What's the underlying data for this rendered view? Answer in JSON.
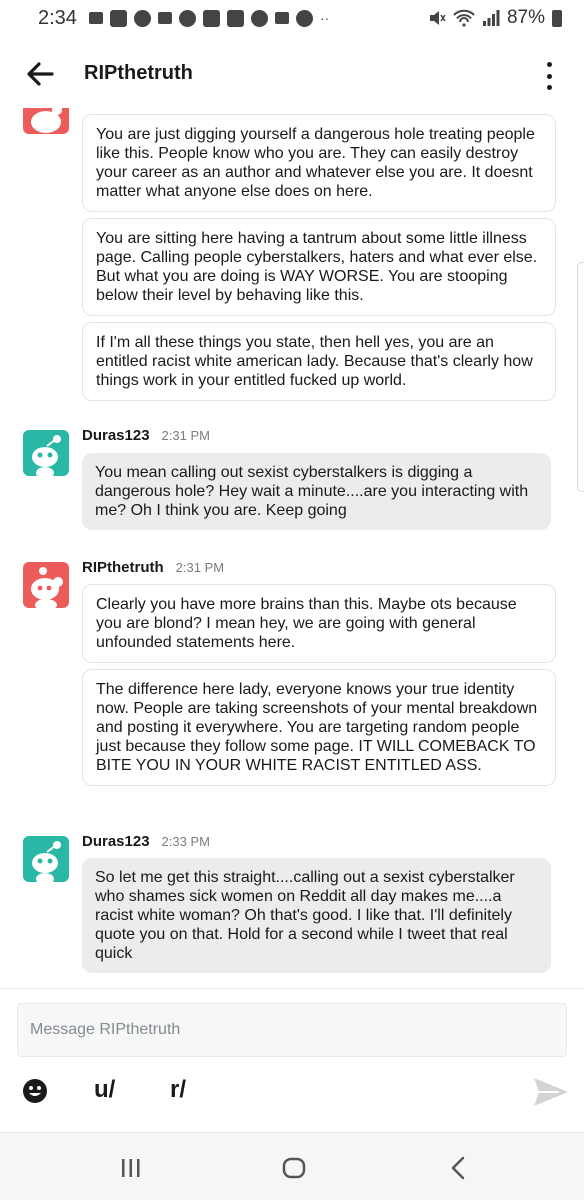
{
  "status_bar": {
    "time": "2:34",
    "icons": [
      "voicemail-icon",
      "chat-icon",
      "messenger-icon",
      "mail-icon",
      "reddit-icon",
      "app-icon",
      "app-icon",
      "google-icon",
      "mail-icon",
      "alert-icon",
      "more-icon"
    ],
    "right_icons": [
      "mute-icon",
      "wifi-icon",
      "signal-icon"
    ],
    "battery": "87%"
  },
  "header": {
    "title": "RIPthetruth"
  },
  "messages": {
    "group1": {
      "bubbles": [
        "You are just digging yourself a dangerous hole treating people like this. People know who you are. They can easily destroy your career as an author and whatever else you are. It doesnt matter what anyone else does on here.",
        "You are sitting here having a tantrum about some little illness page. Calling people cyberstalkers, haters and what ever else. But what you are doing is WAY WORSE. You are stooping below their level by behaving like this.",
        "If I'm all these things you state, then hell yes, you are an entitled racist white american lady. Because that's clearly how things work in your entitled fucked up world."
      ]
    },
    "group2": {
      "author": "Duras123",
      "time": "2:31 PM",
      "bubbles": [
        "You mean calling out sexist cyberstalkers is digging a dangerous hole? Hey wait a minute....are you interacting with me? Oh I think you are. Keep going"
      ]
    },
    "group3": {
      "author": "RIPthetruth",
      "time": "2:31 PM",
      "bubbles": [
        "Clearly you have more brains than this. Maybe ots because you are blond? I mean hey, we are going with general unfounded statements here.",
        "The difference here lady, everyone knows your true identity now. People are taking screenshots of your mental breakdown and posting it everywhere. You are targeting random people just because they follow some page. IT WILL COMEBACK TO BITE YOU IN YOUR WHITE RACIST ENTITLED ASS."
      ]
    },
    "group4": {
      "author": "Duras123",
      "time": "2:33 PM",
      "bubbles": [
        "So let me get this straight....calling out a sexist cyberstalker who shames sick women on Reddit all day makes me....a racist white woman? Oh that's good. I like that. I'll definitely quote you on that. Hold for a second while I tweet that real quick"
      ]
    }
  },
  "composer": {
    "placeholder": "Message RIPthetruth",
    "user_mention": "u/",
    "subreddit_mention": "r/"
  },
  "colors": {
    "accent_red": "#ed5b5b",
    "accent_teal": "#29b8a6",
    "incoming_bubble": "#ececec"
  }
}
